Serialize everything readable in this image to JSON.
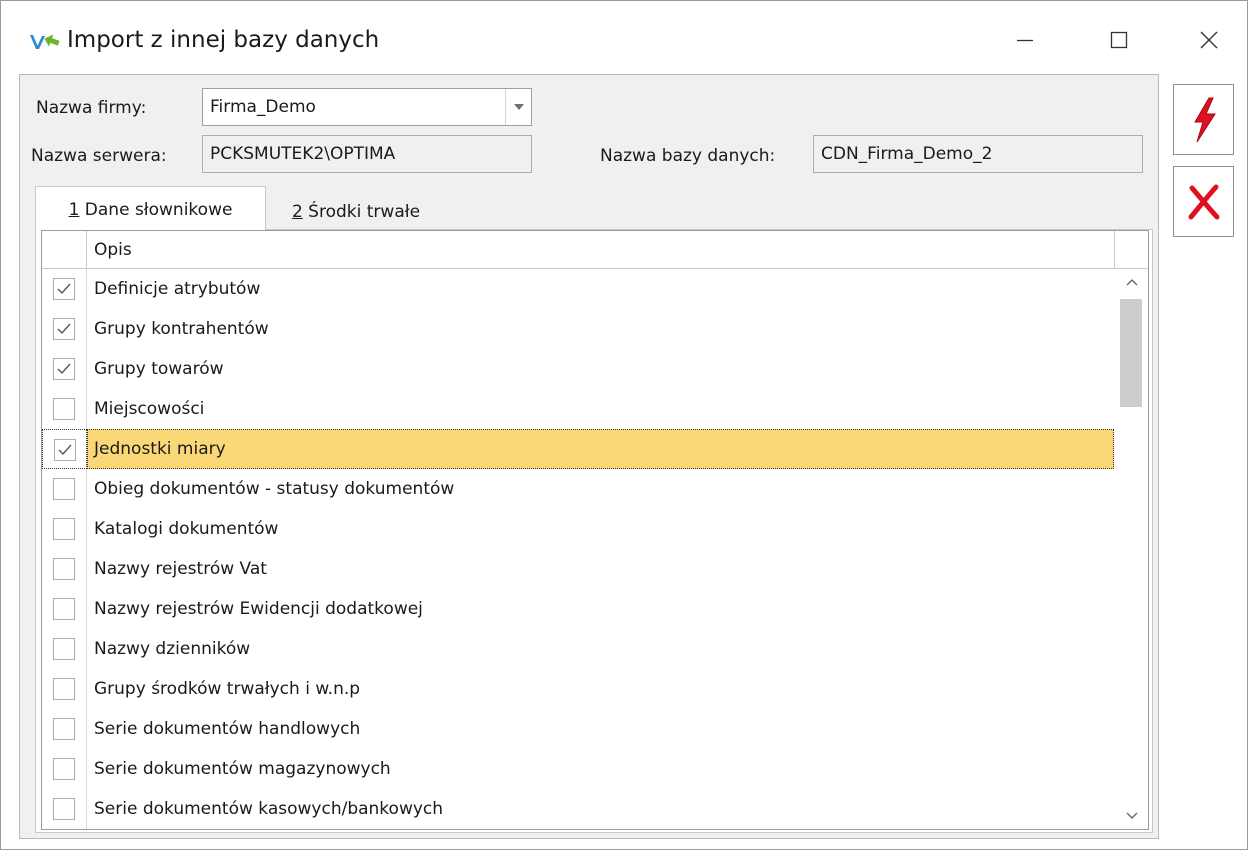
{
  "window": {
    "title": "Import z innej bazy danych"
  },
  "form": {
    "company_label": "Nazwa firmy:",
    "company_value": "Firma_Demo",
    "server_label": "Nazwa serwera:",
    "server_value": "PCKSMUTEK2\\OPTIMA",
    "database_label": "Nazwa bazy danych:",
    "database_value": "CDN_Firma_Demo_2"
  },
  "tabs": [
    {
      "accel": "1",
      "label": " Dane słownikowe",
      "active": true
    },
    {
      "accel": "2",
      "label": " Środki trwałe",
      "active": false
    }
  ],
  "grid": {
    "column_opis": "Opis",
    "rows": [
      {
        "label": "Definicje atrybutów",
        "checked": true
      },
      {
        "label": "Grupy kontrahentów",
        "checked": true
      },
      {
        "label": "Grupy towarów",
        "checked": true
      },
      {
        "label": "Miejscowości",
        "checked": false
      },
      {
        "label": "Jednostki miary",
        "checked": true,
        "selected": true
      },
      {
        "label": "Obieg dokumentów - statusy dokumentów",
        "checked": false
      },
      {
        "label": "Katalogi dokumentów",
        "checked": false
      },
      {
        "label": "Nazwy rejestrów Vat",
        "checked": false
      },
      {
        "label": "Nazwy rejestrów Ewidencji dodatkowej",
        "checked": false
      },
      {
        "label": "Nazwy dzienników",
        "checked": false
      },
      {
        "label": "Grupy środków trwałych i w.n.p",
        "checked": false
      },
      {
        "label": "Serie dokumentów handlowych",
        "checked": false
      },
      {
        "label": "Serie dokumentów magazynowych",
        "checked": false
      },
      {
        "label": "Serie dokumentów kasowych/bankowych",
        "checked": false
      }
    ]
  },
  "colors": {
    "selected_row": "#fbd877",
    "accent_red": "#e0101e",
    "panel_bg": "#f0f0f0"
  },
  "icons": {
    "app": "import-arrows-icon",
    "save": "lightning-bolt-icon",
    "cancel": "red-x-icon"
  }
}
